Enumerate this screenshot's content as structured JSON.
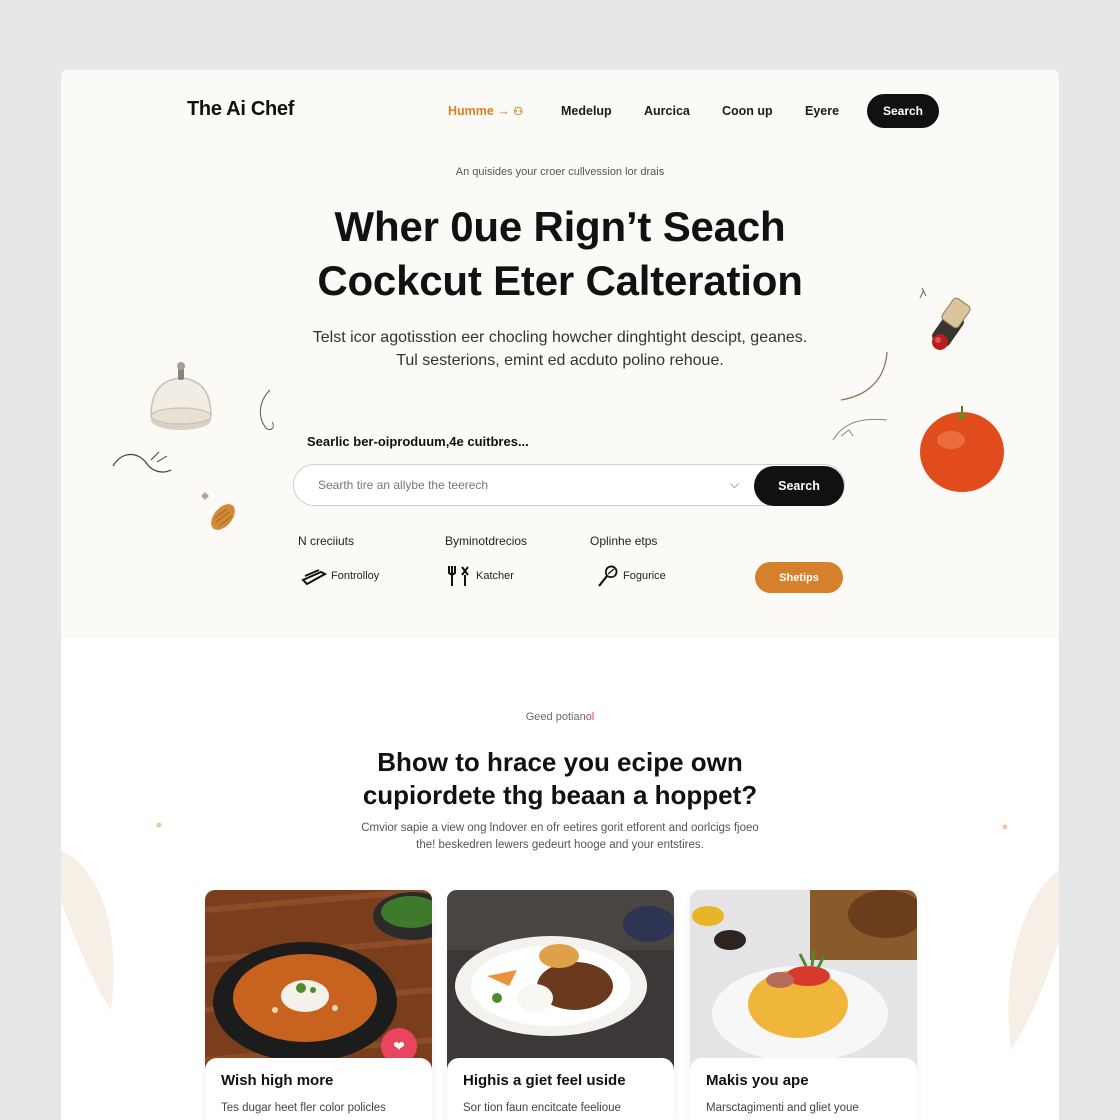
{
  "brand": {
    "name": "The Ai Chef"
  },
  "nav": {
    "items": [
      {
        "label": "Humme →",
        "active": true
      },
      {
        "label": "Medelup"
      },
      {
        "label": "Aurcica"
      },
      {
        "label": "Coon up"
      },
      {
        "label": "Eyere"
      }
    ],
    "cta": "Search"
  },
  "hero": {
    "tagline": "An quisides your croer cullvession lor drais",
    "headline_line1": "Wher 0ue Rign’t Seach",
    "headline_line2": "Cockcut Eter Calteration",
    "subhead_line1": "Telst icor agotisstion eer chocling howcher dinghtight descipt, geanes.",
    "subhead_line2": "Tul sesterions, emint ed acduto polino rehoue."
  },
  "search": {
    "label": "Searlic ber-oiproduum,4e cuitbres...",
    "placeholder": "Searth tire an allybe the teerech",
    "button": "Search"
  },
  "filters": {
    "headers": [
      "N creciiuts",
      "Byminotdrecios",
      "Oplinhe etps"
    ],
    "options": [
      {
        "label": "Fontrolloy",
        "icon": "knife-icon"
      },
      {
        "label": "Katcher",
        "icon": "utensils-icon"
      },
      {
        "label": "Fogurice",
        "icon": "whisk-icon"
      }
    ],
    "action": "Shetips"
  },
  "section": {
    "label": "Geed potian",
    "label_accent": "ol",
    "title_line1": "Bhow to hrace you ecipe own",
    "title_line2": "cupiordete thg beaan a hoppet?",
    "desc_line1": "Cmvior sapie a view ong lndover en ofr eetires gorit etforent and oorlcigs fjoeo",
    "desc_line2": "the! beskedren lewers gedeurt hooge and your entstires."
  },
  "cards": [
    {
      "title": "Wish high more",
      "desc": "Tes dugar heet fler color policles"
    },
    {
      "title": "Highis a giet feel uside",
      "desc": "Sor tion faun encitcate feelioue"
    },
    {
      "title": "Makis you ape",
      "desc": "Marsctagimenti and gliet youe"
    }
  ],
  "colors": {
    "accent": "#d8801f",
    "button_dark": "#111111",
    "favorite": "#e8455f",
    "hero_bg": "#fbfaf7"
  }
}
